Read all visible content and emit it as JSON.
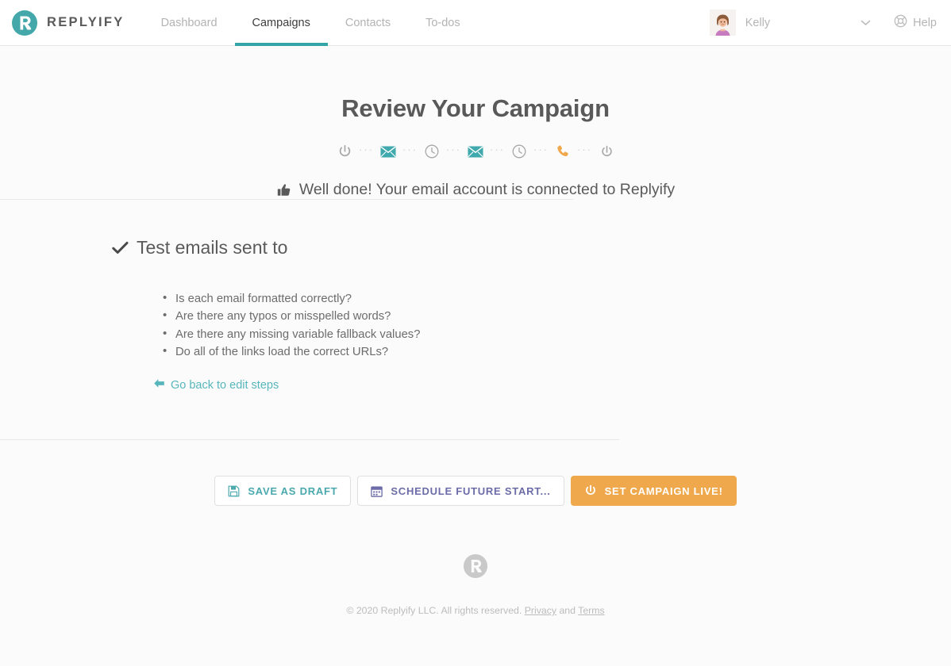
{
  "colors": {
    "brand_teal": "#34a4a6",
    "link_teal": "#57b6bb",
    "accent_orange": "#efa94c",
    "schedule_purple": "#6c6ca8",
    "text_gray": "#5a5a5a",
    "muted_gray": "#b5b5b5"
  },
  "header": {
    "brand_name": "REPLYIFY",
    "brand_logo_icon": "replyify-r-logo-icon",
    "tabs": [
      {
        "label": "Dashboard",
        "active": false
      },
      {
        "label": "Campaigns",
        "active": true
      },
      {
        "label": "Contacts",
        "active": false
      },
      {
        "label": "To-dos",
        "active": false
      }
    ],
    "user": {
      "name": "Kelly",
      "avatar_icon": "user-avatar-woman",
      "caret_icon": "chevron-down-icon"
    },
    "help": {
      "label": "Help",
      "icon": "life-ring-icon"
    }
  },
  "main": {
    "title": "Review Your Campaign",
    "steps": [
      {
        "icon": "power-icon",
        "color": "#a8a8a8"
      },
      {
        "icon": "envelope-icon",
        "color": "#3fa9ad"
      },
      {
        "icon": "clock-icon",
        "color": "#a8a8a8"
      },
      {
        "icon": "envelope-icon",
        "color": "#3fa9ad"
      },
      {
        "icon": "clock-icon",
        "color": "#a8a8a8"
      },
      {
        "icon": "phone-icon",
        "color": "#efa94c"
      },
      {
        "icon": "power-off-icon",
        "color": "#a8a8a8"
      }
    ],
    "step_separator": "···",
    "connected_message": "Well done! Your email account is connected to Replyify",
    "connected_icon": "thumbs-up-icon",
    "review_heading": "Test emails sent to",
    "review_heading_icon": "check-icon",
    "checklist": [
      "Is each email formatted correctly?",
      "Are there any typos or misspelled words?",
      "Are there any missing variable fallback values?",
      "Do all of the links load the correct URLs?"
    ],
    "back_link": {
      "label": "Go back to edit steps",
      "icon": "arrow-left-icon"
    }
  },
  "actions": [
    {
      "label": "SAVE AS DRAFT",
      "icon": "save-floppy-icon",
      "style": "draft"
    },
    {
      "label": "SCHEDULE FUTURE START...",
      "icon": "calendar-icon",
      "style": "schedule"
    },
    {
      "label": "SET CAMPAIGN LIVE!",
      "icon": "power-icon",
      "style": "live"
    }
  ],
  "footer": {
    "logo_icon": "replyify-r-logo-gray-icon",
    "copyright_prefix": "© 2020 Replyify LLC. All rights reserved. ",
    "privacy_label": "Privacy",
    "and_label": " and ",
    "terms_label": "Terms"
  }
}
